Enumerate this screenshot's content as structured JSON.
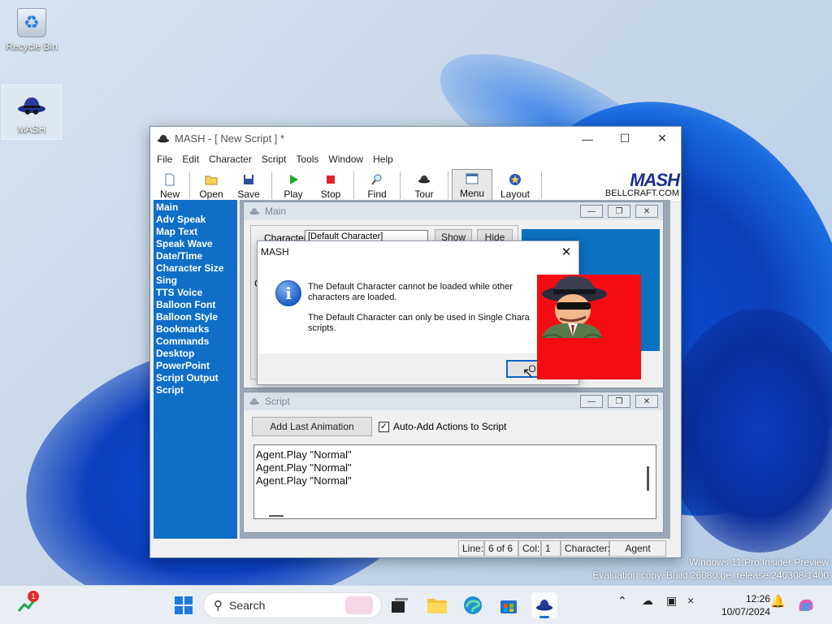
{
  "desktop": {
    "icons": [
      {
        "label": "Recycle Bin"
      },
      {
        "label": "MASH"
      }
    ],
    "watermark_line1": "Windows 11 Pro Insider Preview",
    "watermark_line2": "Evaluation copy. Build 26080.ge_release.240308-1400"
  },
  "window": {
    "title": "MASH - [ New Script ] *",
    "menu": [
      "File",
      "Edit",
      "Character",
      "Script",
      "Tools",
      "Window",
      "Help"
    ],
    "toolbar": [
      "New",
      "Open",
      "Save",
      "Play",
      "Stop",
      "Find",
      "Tour",
      "Menu",
      "Layout"
    ],
    "brand": "MASH",
    "brand_url": "BELLCRAFT.COM",
    "sidebar": [
      "Main",
      "Adv Speak",
      "Map Text",
      "Speak Wave",
      "Date/Time",
      "Character Size",
      "Sing",
      "TTS Voice",
      "Balloon Font",
      "Balloon Style",
      "Bookmarks",
      "Commands",
      "Desktop",
      "PowerPoint",
      "Script Output",
      "Script"
    ],
    "main_child": {
      "title": "Main",
      "character_label": "Character",
      "character_value": "[Default Character]",
      "show_label": "Show",
      "hide_label": "Hide",
      "g_label": "G"
    },
    "script_child": {
      "title": "Script",
      "add_last_animation": "Add Last Animation",
      "auto_add_label": "Auto-Add Actions to Script",
      "auto_add_checked": true,
      "lines": [
        "Agent.Play \"Normal\"",
        "Agent.Play \"Normal\"",
        "Agent.Play \"Normal\""
      ]
    },
    "status": {
      "line_label": "Line:",
      "line_value": "6 of 6",
      "col_label": "Col:",
      "col_value": "1",
      "character_label": "Character:",
      "character_value": "Agent"
    }
  },
  "dialog": {
    "title": "MASH",
    "message1": "The Default Character cannot be loaded while other characters are loaded.",
    "message2": "The Default Character can only be used in Single Chara scripts.",
    "ok_label": "O"
  },
  "taskbar": {
    "search_placeholder": "Search",
    "badge_count": "1",
    "time": "12:26",
    "date": "10/07/2024"
  }
}
